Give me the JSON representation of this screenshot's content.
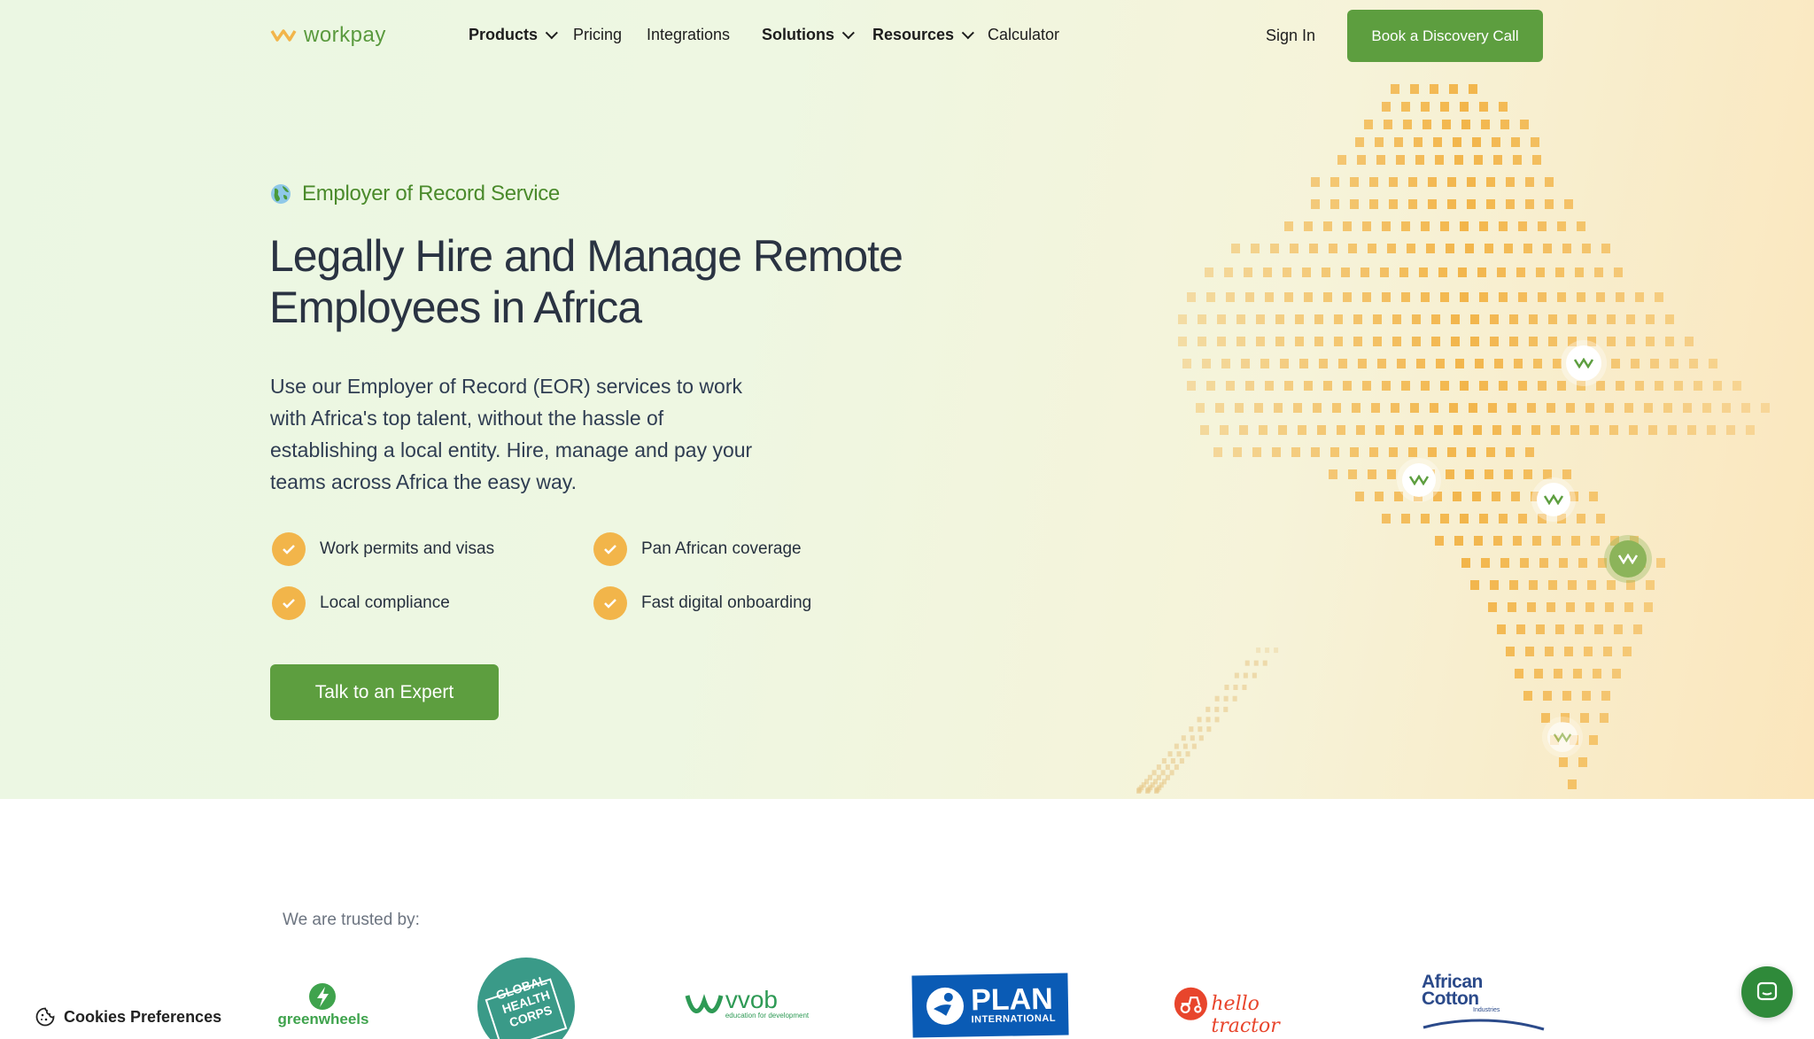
{
  "brand": {
    "name": "workpay",
    "color": "#5d9e3f",
    "accent": "#f2b54a"
  },
  "nav": {
    "items": [
      {
        "label": "Products",
        "dropdown": true
      },
      {
        "label": "Pricing",
        "dropdown": false
      },
      {
        "label": "Integrations",
        "dropdown": false
      },
      {
        "label": "Solutions",
        "dropdown": true
      },
      {
        "label": "Resources",
        "dropdown": true
      },
      {
        "label": "Calculator",
        "dropdown": false
      }
    ],
    "sign_in": "Sign In",
    "book_call": "Book a Discovery Call"
  },
  "hero": {
    "eyebrow": "Employer of Record Service",
    "headline_line1": "Legally Hire and Manage Remote",
    "headline_line2": "Employees in Africa",
    "description": "Use our Employer of Record (EOR) services to work with Africa's top talent, without the hassle of establishing a local entity. Hire, manage and pay your teams across Africa the easy way.",
    "features": [
      "Work permits and visas",
      "Pan African coverage",
      "Local compliance",
      "Fast digital onboarding"
    ],
    "cta": "Talk to an Expert"
  },
  "trusted": {
    "label": "We are trusted by:",
    "logos": [
      {
        "name": "greenwheels",
        "icon": "greenwheels-logo"
      },
      {
        "name": "GLOBAL HEALTH CORPS",
        "icon": "global-health-corps-logo"
      },
      {
        "name": "vvob",
        "sub": "education for development",
        "icon": "vvob-logo"
      },
      {
        "name": "PLAN",
        "sub": "INTERNATIONAL",
        "icon": "plan-international-logo"
      },
      {
        "name": "hello tractor",
        "icon": "hello-tractor-logo"
      },
      {
        "name": "African Cotton",
        "sub": "Industries",
        "icon": "african-cotton-logo"
      }
    ]
  },
  "cookies": {
    "label": "Cookies Preferences"
  },
  "chat": {
    "icon": "chat-icon"
  }
}
